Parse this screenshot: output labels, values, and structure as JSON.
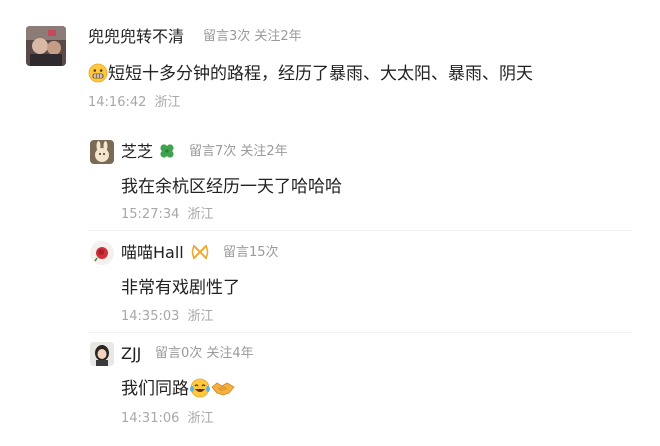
{
  "comments": [
    {
      "user": "兜兜兜转不清",
      "meta": "留言3次 关注2年",
      "content": "短短十多分钟的路程，经历了暴雨、大太阳、暴雨、阴天",
      "time": "14:16:42",
      "location": "浙江",
      "emoji": "grimacing-face-icon"
    },
    {
      "user": "芝芝",
      "badge": "four-leaf-clover-icon",
      "meta": "留言7次 关注2年",
      "content": "我在余杭区经历一天了哈哈哈",
      "time": "15:27:34",
      "location": "浙江"
    },
    {
      "user": "喵喵Hall",
      "badge": "gold-ribbon-icon",
      "meta": "留言15次",
      "content": "非常有戏剧性了",
      "time": "14:35:03",
      "location": "浙江"
    },
    {
      "user": "ZJJ",
      "meta": "留言0次 关注4年",
      "content": "我们同路",
      "emojis": [
        "tears-of-joy-icon",
        "handshake-icon"
      ],
      "time": "14:31:06",
      "location": "浙江"
    }
  ]
}
